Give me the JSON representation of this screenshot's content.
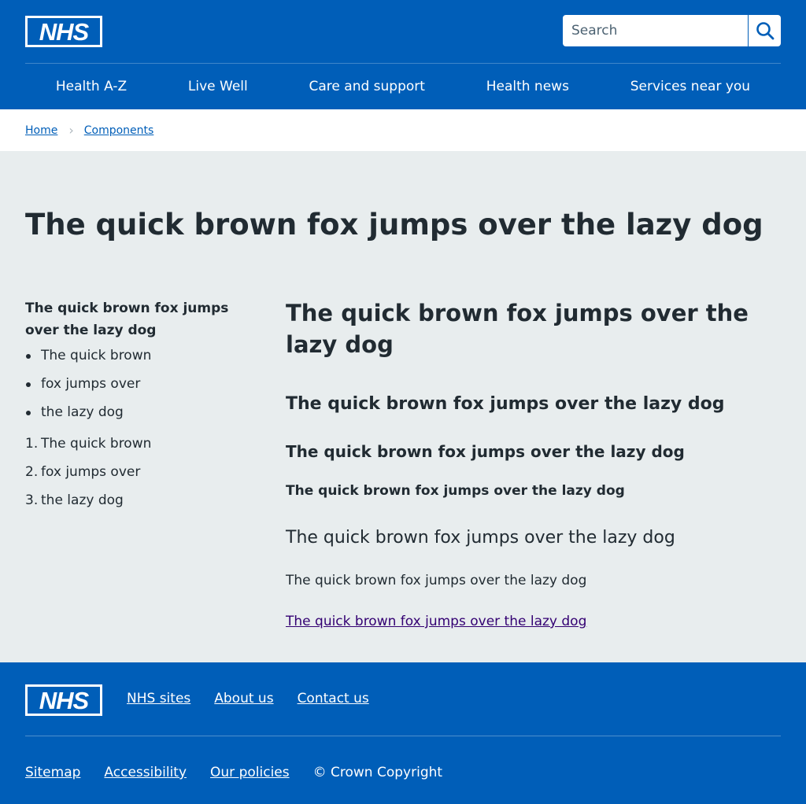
{
  "colors": {
    "brand_blue": "#005eb8",
    "text": "#212b32",
    "page_background": "#e8edee",
    "visited_link": "#330072"
  },
  "header": {
    "logo_text": "NHS",
    "search": {
      "placeholder": "Search",
      "value": "",
      "icon": "search-icon"
    },
    "nav": [
      "Health A-Z",
      "Live Well",
      "Care and support",
      "Health news",
      "Services near you"
    ]
  },
  "breadcrumb": {
    "items": [
      "Home",
      "Components"
    ],
    "separator": "›"
  },
  "main": {
    "page_title": "The quick brown fox jumps over the lazy dog",
    "sidebar": {
      "heading": "The quick brown fox jumps over the lazy dog",
      "bullets": [
        "The quick brown",
        "fox jumps over",
        "the lazy dog"
      ],
      "numbered": [
        "The quick brown",
        "fox jumps over",
        "the lazy dog"
      ],
      "numbers": [
        "1.",
        "2.",
        "3."
      ]
    },
    "content": {
      "heading_1": "The quick brown fox jumps over the lazy dog",
      "heading_2": "The quick brown fox jumps over the lazy dog",
      "heading_3": "The quick brown fox jumps over the lazy dog",
      "heading_4": "The quick brown fox jumps over the lazy dog",
      "lede": "The quick brown fox jumps over the lazy dog",
      "body": "The quick brown fox jumps over the lazy dog",
      "link": "The quick brown fox jumps over the lazy dog"
    }
  },
  "footer": {
    "logo_text": "NHS",
    "links_primary": [
      "NHS sites",
      "About us",
      "Contact us"
    ],
    "links_secondary": [
      "Sitemap",
      "Accessibility",
      "Our policies"
    ],
    "copyright": "© Crown Copyright"
  }
}
